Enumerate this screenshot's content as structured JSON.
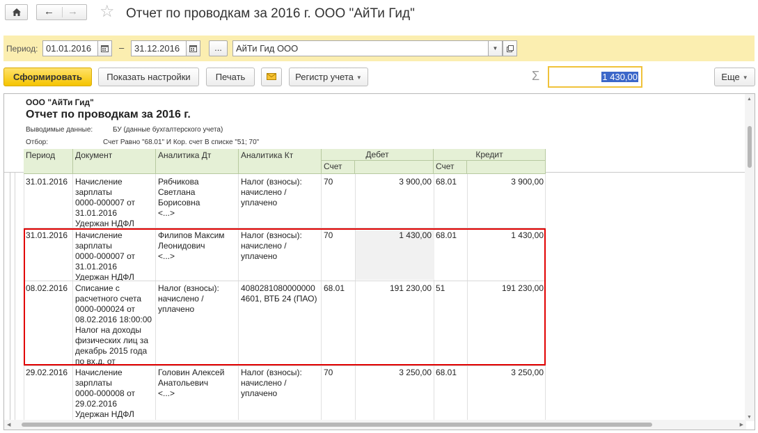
{
  "window": {
    "title": "Отчет по проводкам за 2016 г. ООО \"АйТи Гид\""
  },
  "filter": {
    "period_label": "Период:",
    "date_from": "01.01.2016",
    "dash": "–",
    "date_to": "31.12.2016",
    "dots": "...",
    "organization": "АйТи Гид ООО"
  },
  "toolbar": {
    "generate": "Сформировать",
    "show_settings": "Показать настройки",
    "print": "Печать",
    "register": "Регистр учета",
    "sigma": "Σ",
    "sum_value": "1 430,00",
    "more": "Еще"
  },
  "report": {
    "org": "ООО \"АйТи Гид\"",
    "title": "Отчет по проводкам за 2016 г.",
    "output_label": "Выводимые данные:",
    "output_value": "БУ (данные бухгалтерского учета)",
    "filter_label": "Отбор:",
    "filter_value": "Счет Равно \"68.01\" И Кор. счет В списке \"51; 70\"",
    "headers": {
      "period": "Период",
      "document": "Документ",
      "analytics_dt": "Аналитика Дт",
      "analytics_kt": "Аналитика Кт",
      "debit": "Дебет",
      "credit": "Кредит",
      "account_d": "Счет",
      "account_c": "Счет"
    },
    "rows": [
      {
        "period": "31.01.2016",
        "document": "Начисление\nзарплаты\n0000-000007 от\n31.01.2016\nУдержан НДФЛ",
        "dt": "Рябчикова\nСветлана\nБорисовна\n<...>",
        "kt": "Налог (взносы):\nначислено /\nуплачено",
        "d_acc": "70",
        "d_sum": "3 900,00",
        "c_acc": "68.01",
        "c_sum": "3 900,00"
      },
      {
        "period": "31.01.2016",
        "document": "Начисление\nзарплаты\n0000-000007 от\n31.01.2016\nУдержан НДФЛ",
        "dt": "Филипов Максим\nЛеонидович\n<...>",
        "kt": "Налог (взносы):\nначислено /\nуплачено",
        "d_acc": "70",
        "d_sum": "1 430,00",
        "c_acc": "68.01",
        "c_sum": "1 430,00"
      },
      {
        "period": "08.02.2016",
        "document": "Списание с\nрасчетного счета\n0000-000024 от\n08.02.2016 18:00:00\nНалог на доходы\nфизических лиц за\nдекабрь 2015 года\nпо вх.д.  от",
        "dt": "Налог (взносы):\nначислено /\nуплачено",
        "kt": "4080281080000000\n4601, ВТБ 24 (ПАО)",
        "d_acc": "68.01",
        "d_sum": "191 230,00",
        "c_acc": "51",
        "c_sum": "191 230,00"
      },
      {
        "period": "29.02.2016",
        "document": "Начисление\nзарплаты\n0000-000008 от\n29.02.2016\nУдержан НДФЛ",
        "dt": "Головин Алексей\nАнатольевич\n<...>",
        "kt": "Налог (взносы):\nначислено /\nуплачено",
        "d_acc": "70",
        "d_sum": "3 250,00",
        "c_acc": "68.01",
        "c_sum": "3 250,00"
      }
    ]
  }
}
